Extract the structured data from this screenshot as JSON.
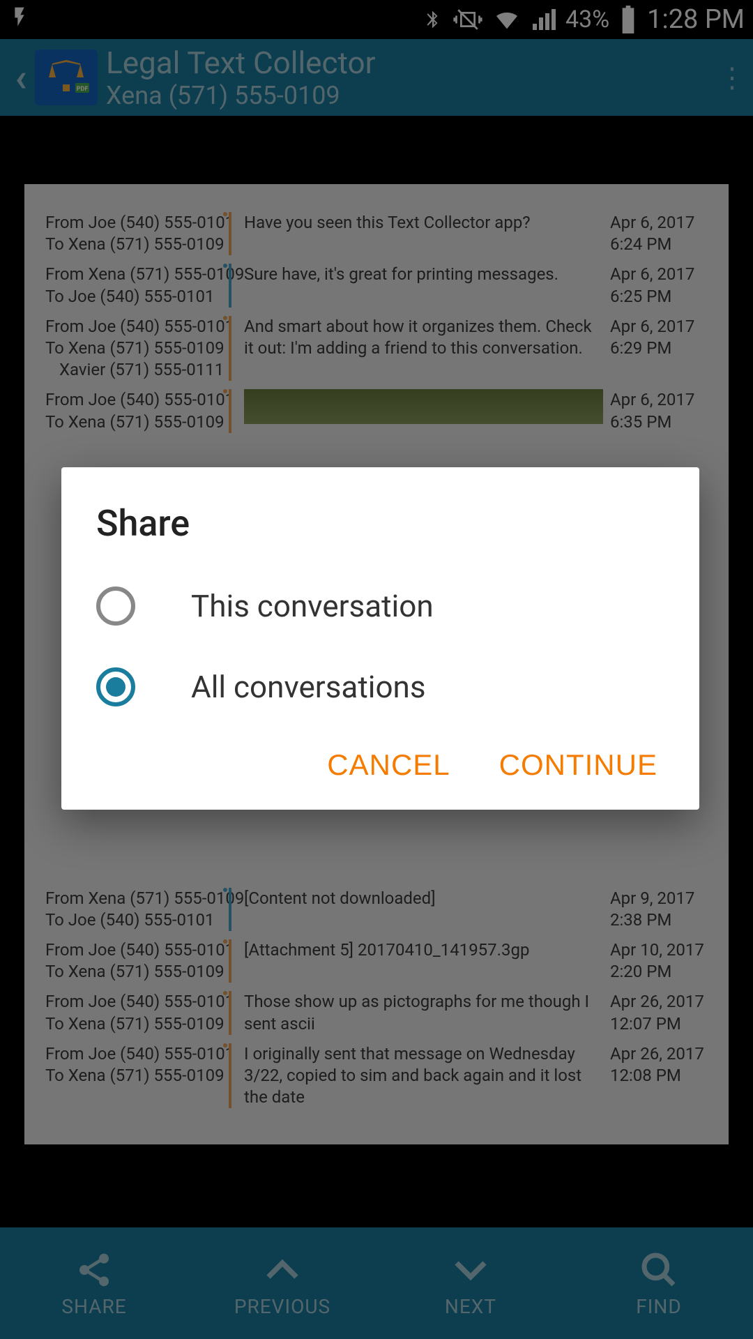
{
  "status": {
    "battery_pct": "43%",
    "time": "1:28 PM"
  },
  "header": {
    "title": "Legal Text Collector",
    "subtitle": "Xena (571) 555-0109"
  },
  "messages": [
    {
      "from": "From Joe (540) 555-0101",
      "to": "To Xena (571) 555-0109",
      "extra": "",
      "body": "Have you seen this Text Collector app?",
      "date": "Apr 6, 2017",
      "time": "6:24 PM",
      "dir": "orange"
    },
    {
      "from": "From Xena (571) 555-0109",
      "to": "To Joe (540) 555-0101",
      "extra": "",
      "body": "Sure have, it's great for printing messages.",
      "date": "Apr 6, 2017",
      "time": "6:25 PM",
      "dir": "blue"
    },
    {
      "from": "From Joe (540) 555-0101",
      "to": "To Xena (571) 555-0109",
      "extra": "Xavier (571) 555-0111",
      "body": "And smart about how it organizes them. Check it out: I'm adding a friend to this conversation.",
      "date": "Apr 6, 2017",
      "time": "6:29 PM",
      "dir": "orange"
    },
    {
      "from": "From Joe (540) 555-0101",
      "to": "To Xena (571) 555-0109",
      "extra": "",
      "body": "",
      "date": "Apr 6, 2017",
      "time": "6:35 PM",
      "dir": "orange",
      "img": true
    },
    {
      "from": "From Xena (571) 555-0109",
      "to": "To Joe (540) 555-0101",
      "extra": "",
      "body": "[Content not downloaded]",
      "date": "Apr 9, 2017",
      "time": "2:38 PM",
      "dir": "blue"
    },
    {
      "from": "From Joe (540) 555-0101",
      "to": "To Xena (571) 555-0109",
      "extra": "",
      "body": "[Attachment 5] 20170410_141957.3gp",
      "date": "Apr 10, 2017",
      "time": "2:20 PM",
      "dir": "orange"
    },
    {
      "from": "From Joe (540) 555-0101",
      "to": "To Xena (571) 555-0109",
      "extra": "",
      "body": "Those show up as pictographs for me though I sent ascii",
      "date": "Apr 26, 2017",
      "time": "12:07 PM",
      "dir": "orange"
    },
    {
      "from": "From Joe (540) 555-0101",
      "to": "To Xena (571) 555-0109",
      "extra": "",
      "body": "I originally sent that message on Wednesday 3/22, copied to sim and back again and it lost the date",
      "date": "Apr 26, 2017",
      "time": "12:08 PM",
      "dir": "orange"
    }
  ],
  "nav": {
    "share": "SHARE",
    "previous": "PREVIOUS",
    "next": "NEXT",
    "find": "FIND"
  },
  "dialog": {
    "title": "Share",
    "option1": "This conversation",
    "option2": "All conversations",
    "cancel": "CANCEL",
    "continue": "CONTINUE",
    "selected": 2
  }
}
